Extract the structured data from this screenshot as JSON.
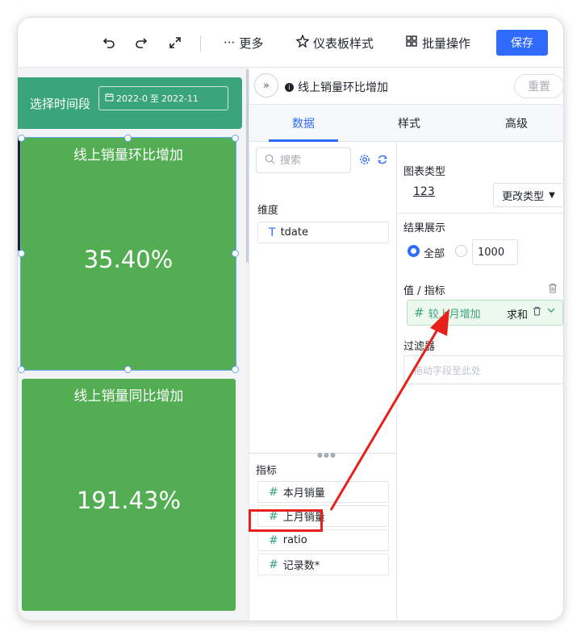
{
  "toolbar": {
    "undo_icon": "undo-icon",
    "redo_icon": "redo-icon",
    "fullscreen_icon": "expand-icon",
    "more_label": "更多",
    "dashboard_style_label": "仪表板样式",
    "batch_ops_label": "批量操作",
    "save_label": "保存",
    "accent_color": "#2f6bff"
  },
  "canvas": {
    "time_filter": {
      "label": "选择时间段",
      "range_start": "2022-0",
      "range_sep": "至",
      "range_end": "2022-11"
    },
    "kpis": [
      {
        "title": "线上销量环比增加",
        "value": "35.40%",
        "color": "#52ad53"
      },
      {
        "title": "线上销量同比增加",
        "value": "191.43%",
        "color": "#52ad53"
      }
    ]
  },
  "panel": {
    "title": "线上销量环比增加",
    "reset_label": "重置",
    "tabs": [
      {
        "label": "数据",
        "active": true
      },
      {
        "label": "样式",
        "active": false
      },
      {
        "label": "高级",
        "active": false
      }
    ],
    "search": {
      "placeholder": "搜索"
    },
    "dimension_label": "维度",
    "dimensions": [
      {
        "symbol": "T",
        "name": "tdate"
      }
    ],
    "measure_label": "指标",
    "measures": [
      {
        "symbol": "#",
        "name": "本月销量"
      },
      {
        "symbol": "#",
        "name": "上月销量"
      },
      {
        "symbol": "#",
        "name": "ratio"
      },
      {
        "symbol": "#",
        "name": "记录数*"
      }
    ],
    "chart_type_label": "图表类型",
    "chart_type_icon_text": "123",
    "change_type_label": "更改类型",
    "result_label": "结果展示",
    "result_options": [
      {
        "label": "全部",
        "checked": true
      },
      {
        "label": "",
        "checked": false
      }
    ],
    "result_limit_value": "1000",
    "value_measure_label": "值 / 指标",
    "value_measure_chip": {
      "symbol": "#",
      "name": "较上月增加",
      "agg": "求和"
    },
    "filter_label": "过滤器",
    "filter_placeholder": "拖动字段至此处"
  },
  "annotation_color": "#e8201b"
}
